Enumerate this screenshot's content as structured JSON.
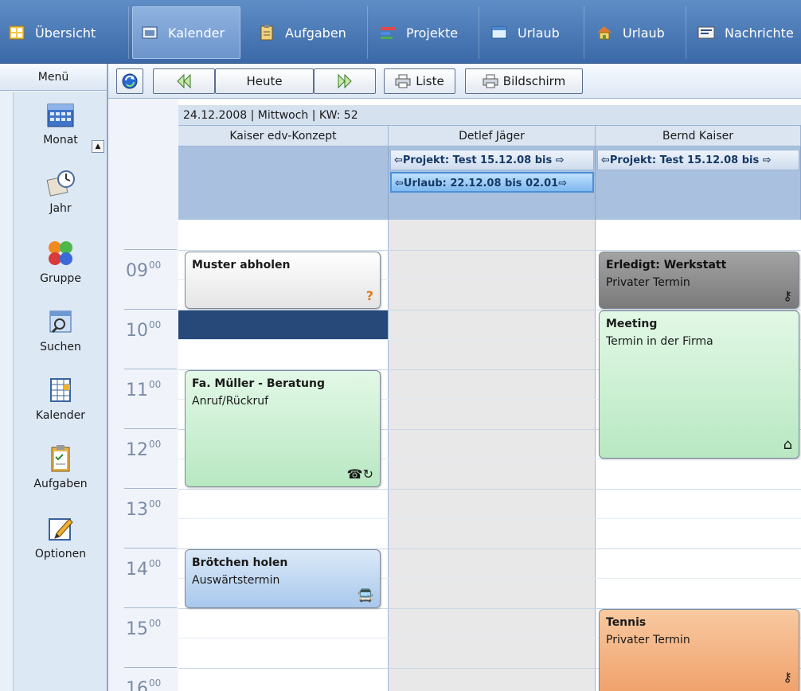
{
  "nav": {
    "tabs": [
      {
        "label": "Übersicht",
        "icon": "overview-icon"
      },
      {
        "label": "Kalender",
        "icon": "calendar-icon",
        "active": true
      },
      {
        "label": "Aufgaben",
        "icon": "tasks-icon"
      },
      {
        "label": "Projekte",
        "icon": "projects-icon"
      },
      {
        "label": "Urlaub",
        "icon": "window-icon"
      },
      {
        "label": "Urlaub",
        "icon": "house-icon"
      },
      {
        "label": "Nachrichte",
        "icon": "message-icon"
      }
    ]
  },
  "menu": {
    "title": "Menü",
    "items": [
      "Monat",
      "Jahr",
      "Gruppe",
      "Suchen",
      "Kalender",
      "Aufgaben",
      "Optionen"
    ]
  },
  "toolbar": {
    "today_label": "Heute",
    "list_label": "Liste",
    "screen_label": "Bildschirm"
  },
  "calendar": {
    "date_line": "24.12.2008 | Mittwoch | KW: 52",
    "columns": [
      "Kaiser edv-Konzept",
      "Detlef Jäger",
      "Bernd Kaiser"
    ],
    "span_events": {
      "projekt_1": "⇦Projekt: Test 15.12.08 bis ⇨",
      "projekt_2": "⇦Projekt: Test 15.12.08 bis ⇨",
      "urlaub": "⇦Urlaub: 22.12.08 bis 02.01⇨"
    },
    "hours": [
      "09",
      "10",
      "11",
      "12",
      "13",
      "14",
      "15",
      "16"
    ],
    "hour_suffix": "00",
    "appointments": {
      "muster": {
        "title": "Muster abholen",
        "icon": "question-icon",
        "glyph": "?"
      },
      "mueller": {
        "title": "Fa. Müller - Beratung",
        "subtitle": "Anruf/Rückruf",
        "icon": "phone-callback-icon",
        "glyph": "☎↻"
      },
      "broetchen": {
        "title": "Brötchen holen",
        "subtitle": "Auswärtstermin",
        "icon": "bus-icon",
        "glyph": "🚍"
      },
      "werkstatt": {
        "title": "Erledigt: Werkstatt",
        "subtitle": "Privater Termin",
        "icon": "key-icon",
        "glyph": "⚷"
      },
      "meeting": {
        "title": "Meeting",
        "subtitle": "Termin in der Firma",
        "icon": "home-icon",
        "glyph": "⌂"
      },
      "tennis": {
        "title": "Tennis",
        "subtitle": "Privater Termin",
        "icon": "key-icon",
        "glyph": "⚷"
      }
    }
  },
  "colors": {
    "nav_bg": "#4a78b5",
    "appt_green": "#c4eecd",
    "appt_blue": "#bcd6f0",
    "appt_gray": "#8a8a8a",
    "appt_orange": "#f3b27f",
    "selected_slot": "#26497a"
  }
}
